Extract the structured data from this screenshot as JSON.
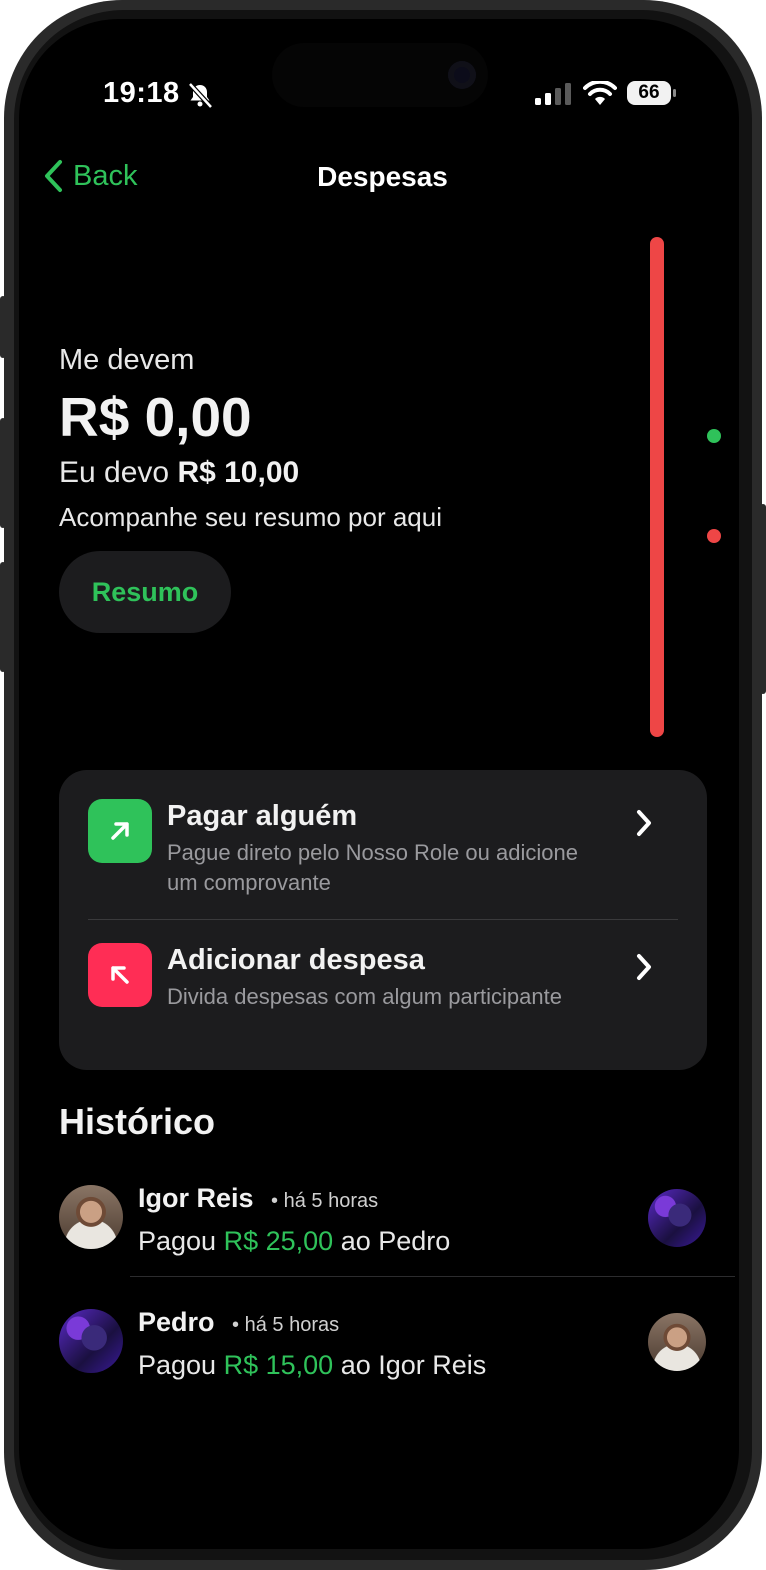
{
  "status": {
    "time": "19:18",
    "battery": "66"
  },
  "nav": {
    "back_label": "Back",
    "title": "Despesas"
  },
  "summary": {
    "owed_label": "Me devem",
    "owed_amount": "R$ 0,00",
    "i_owe_prefix": "Eu devo",
    "i_owe_amount": "R$ 10,00",
    "hint": "Acompanhe seu resumo por aqui",
    "resumo_button": "Resumo"
  },
  "actions": [
    {
      "title": "Pagar alguém",
      "subtitle": "Pague direto pelo Nosso Role ou adicione um comprovante"
    },
    {
      "title": "Adicionar despesa",
      "subtitle": "Divida despesas com algum participante"
    }
  ],
  "history": {
    "title": "Histórico",
    "items": [
      {
        "name": "Igor Reis",
        "time": "há 5 horas",
        "verb": "Pagou",
        "amount": "R$ 25,00",
        "target": "ao Pedro"
      },
      {
        "name": "Pedro",
        "time": "há 5 horas",
        "verb": "Pagou",
        "amount": "R$ 15,00",
        "target": "ao Igor Reis"
      }
    ]
  },
  "colors": {
    "accent": "#2fc25a",
    "danger": "#ee4646",
    "pink": "#ff2d55",
    "card": "#1c1c1e"
  }
}
